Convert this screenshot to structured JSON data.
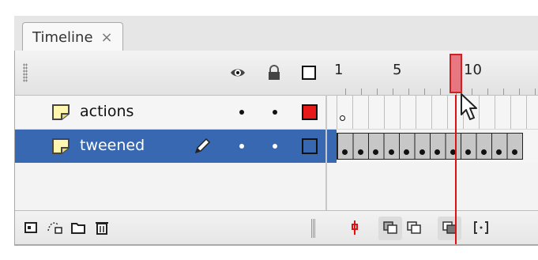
{
  "panel": {
    "tab_title": "Timeline",
    "tab_close": "×"
  },
  "header": {
    "frame_numbers": [
      "1",
      "5",
      "10"
    ],
    "icons": [
      "grip-icon",
      "eye-icon",
      "lock-icon",
      "outline-icon"
    ]
  },
  "layers": [
    {
      "name": "actions",
      "icon": "layer-icon",
      "outline_color": "#e81919",
      "selected": false
    },
    {
      "name": "tweened",
      "icon": "layer-icon",
      "outline_color": "#3868b2",
      "selected": true,
      "editing_icon": "pencil-icon"
    }
  ],
  "playhead": {
    "frame": 9
  },
  "bottom_toolbar": {
    "left_icons": [
      "new-layer-icon",
      "motion-guide-icon",
      "new-folder-icon",
      "delete-layer-icon"
    ],
    "right_icons": [
      "center-frame-icon",
      "onion-skin-icon",
      "onion-skin-outlines-icon",
      "edit-multiple-frames-icon",
      "modify-onion-markers-icon"
    ]
  },
  "colors": {
    "selection": "#3868b2",
    "playhead": "#d11111"
  }
}
